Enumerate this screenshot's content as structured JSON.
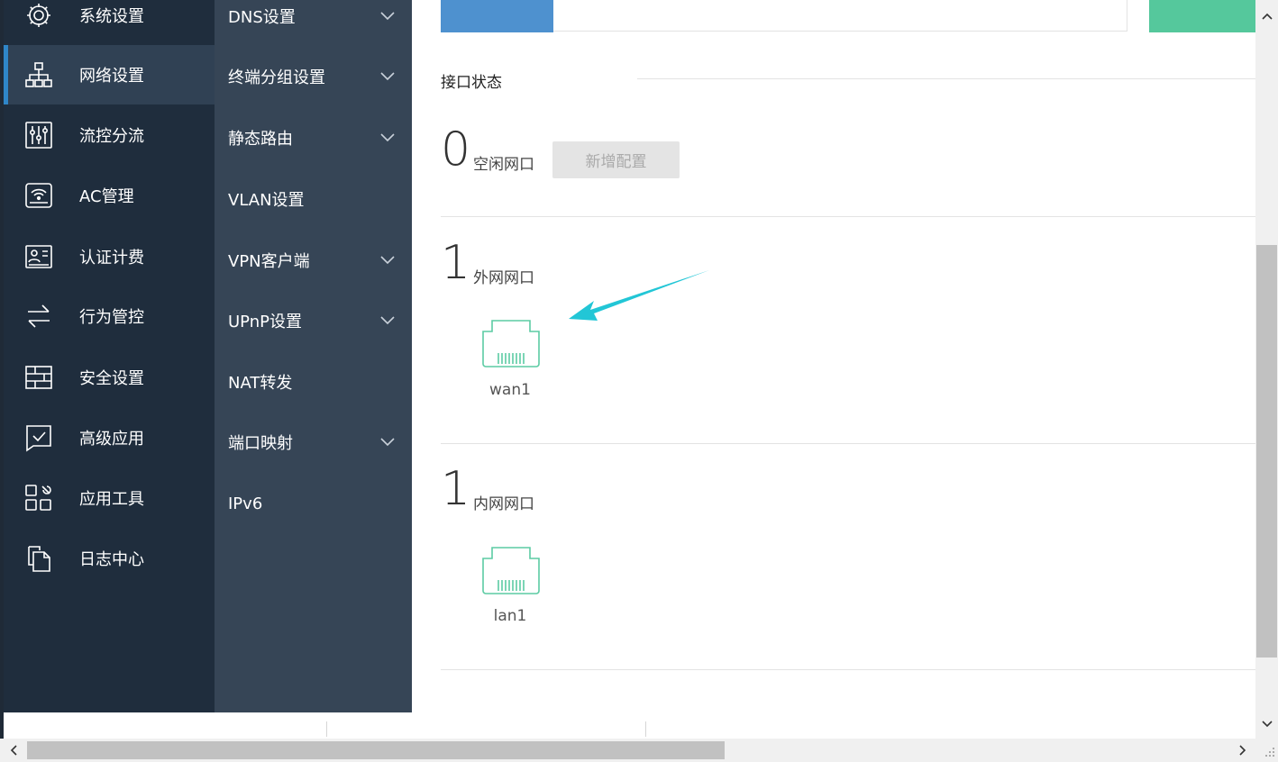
{
  "sidebar": {
    "items": [
      {
        "label": "系统设置",
        "icon": "gear-icon"
      },
      {
        "label": "网络设置",
        "icon": "network-icon",
        "active": true
      },
      {
        "label": "流控分流",
        "icon": "sliders-icon"
      },
      {
        "label": "AC管理",
        "icon": "wifi-router-icon"
      },
      {
        "label": "认证计费",
        "icon": "id-card-icon"
      },
      {
        "label": "行为管控",
        "icon": "swap-arrows-icon"
      },
      {
        "label": "安全设置",
        "icon": "firewall-icon"
      },
      {
        "label": "高级应用",
        "icon": "checklist-icon"
      },
      {
        "label": "应用工具",
        "icon": "apps-icon"
      },
      {
        "label": "日志中心",
        "icon": "documents-icon"
      }
    ]
  },
  "submenu": {
    "items": [
      {
        "label": "DNS设置",
        "expandable": true
      },
      {
        "label": "终端分组设置",
        "expandable": true
      },
      {
        "label": "静态路由",
        "expandable": true
      },
      {
        "label": "VLAN设置",
        "expandable": false
      },
      {
        "label": "VPN客户端",
        "expandable": true
      },
      {
        "label": "UPnP设置",
        "expandable": true
      },
      {
        "label": "NAT转发",
        "expandable": false
      },
      {
        "label": "端口映射",
        "expandable": true
      },
      {
        "label": "IPv6",
        "expandable": false
      }
    ]
  },
  "main": {
    "section_title": "接口状态",
    "idle": {
      "count": "0",
      "label": "空闲网口",
      "button": "新增配置"
    },
    "wan": {
      "count": "1",
      "label": "外网网口",
      "ports": [
        "wan1"
      ]
    },
    "lan": {
      "count": "1",
      "label": "内网网口",
      "ports": [
        "lan1"
      ]
    }
  },
  "colors": {
    "sidebar_bg": "#1f2d3d",
    "submenu_bg": "#364556",
    "active_indicator": "#2f86c8",
    "port_green": "#5ccba3",
    "arrow_cyan": "#22c6d6"
  }
}
